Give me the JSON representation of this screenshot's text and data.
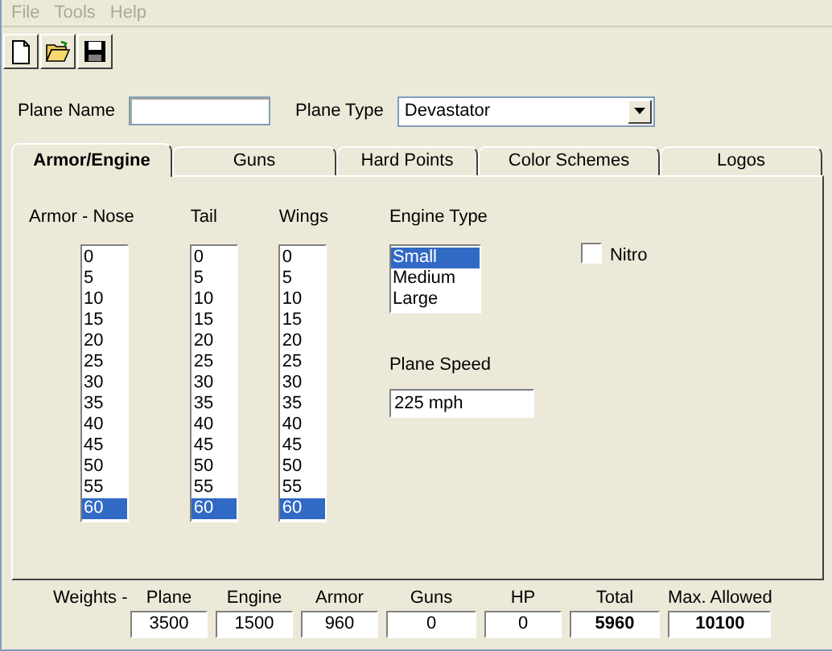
{
  "menu": [
    {
      "label": "File",
      "disabled": true
    },
    {
      "label": "Tools",
      "disabled": true
    },
    {
      "label": "Help",
      "disabled": true
    }
  ],
  "toolbar": [
    {
      "kind": "new"
    },
    {
      "kind": "open"
    },
    {
      "kind": "save"
    }
  ],
  "plane_name": {
    "label": "Plane Name"
  },
  "plane_type": {
    "label": "Plane Type",
    "value": "Devastator"
  },
  "tabs": [
    {
      "label": "Armor/Engine",
      "selected": true
    },
    {
      "label": "Guns",
      "selected": false
    },
    {
      "label": "Hard Points",
      "selected": false
    },
    {
      "label": "Color Schemes",
      "selected": false
    },
    {
      "label": "Logos",
      "selected": false
    }
  ],
  "armor_lists": [
    {
      "label": "Armor - Nose",
      "items": [
        {
          "label": "0",
          "selected": false
        },
        {
          "label": "5",
          "selected": false
        },
        {
          "label": "10",
          "selected": false
        },
        {
          "label": "15",
          "selected": false
        },
        {
          "label": "20",
          "selected": false
        },
        {
          "label": "25",
          "selected": false
        },
        {
          "label": "30",
          "selected": false
        },
        {
          "label": "35",
          "selected": false
        },
        {
          "label": "40",
          "selected": false
        },
        {
          "label": "45",
          "selected": false
        },
        {
          "label": "50",
          "selected": false
        },
        {
          "label": "55",
          "selected": false
        },
        {
          "label": "60",
          "selected": true
        }
      ]
    },
    {
      "label": "Tail",
      "items": [
        {
          "label": "0",
          "selected": false
        },
        {
          "label": "5",
          "selected": false
        },
        {
          "label": "10",
          "selected": false
        },
        {
          "label": "15",
          "selected": false
        },
        {
          "label": "20",
          "selected": false
        },
        {
          "label": "25",
          "selected": false
        },
        {
          "label": "30",
          "selected": false
        },
        {
          "label": "35",
          "selected": false
        },
        {
          "label": "40",
          "selected": false
        },
        {
          "label": "45",
          "selected": false
        },
        {
          "label": "50",
          "selected": false
        },
        {
          "label": "55",
          "selected": false
        },
        {
          "label": "60",
          "selected": true
        }
      ]
    },
    {
      "label": "Wings",
      "items": [
        {
          "label": "0",
          "selected": false
        },
        {
          "label": "5",
          "selected": false
        },
        {
          "label": "10",
          "selected": false
        },
        {
          "label": "15",
          "selected": false
        },
        {
          "label": "20",
          "selected": false
        },
        {
          "label": "25",
          "selected": false
        },
        {
          "label": "30",
          "selected": false
        },
        {
          "label": "35",
          "selected": false
        },
        {
          "label": "40",
          "selected": false
        },
        {
          "label": "45",
          "selected": false
        },
        {
          "label": "50",
          "selected": false
        },
        {
          "label": "55",
          "selected": false
        },
        {
          "label": "60",
          "selected": true
        }
      ]
    }
  ],
  "engine_type": {
    "label": "Engine Type",
    "options": [
      {
        "label": "Small",
        "selected": true
      },
      {
        "label": "Medium",
        "selected": false
      },
      {
        "label": "Large",
        "selected": false
      }
    ]
  },
  "nitro": {
    "label": "Nitro",
    "checked": false
  },
  "plane_speed": {
    "label": "Plane Speed",
    "value": "225 mph"
  },
  "weights": {
    "label": "Weights -",
    "fields": [
      {
        "label": "Plane",
        "value": "3500",
        "emphasized": false
      },
      {
        "label": "Engine",
        "value": "1500",
        "emphasized": false
      },
      {
        "label": "Armor",
        "value": "960",
        "emphasized": false
      },
      {
        "label": "Guns",
        "value": "0",
        "emphasized": false
      },
      {
        "label": "HP",
        "value": "0",
        "emphasized": false
      },
      {
        "label": "Total",
        "value": "5960",
        "emphasized": true
      },
      {
        "label": "Max. Allowed",
        "value": "10100",
        "emphasized": true
      }
    ]
  }
}
